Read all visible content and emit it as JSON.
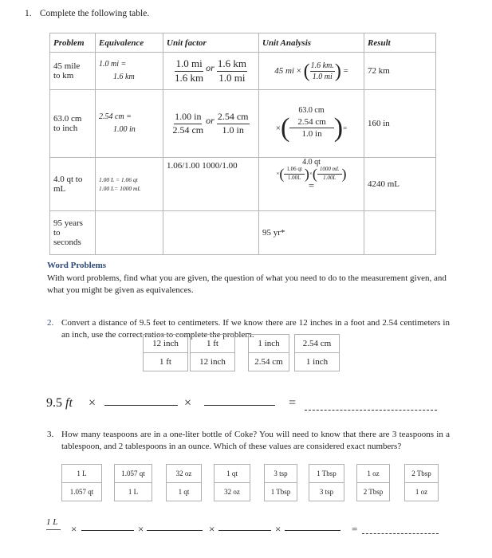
{
  "question1": {
    "number": "1.",
    "prompt": "Complete the following table.",
    "headers": [
      "Problem",
      "Equivalence",
      "Unit factor",
      "Unit Analysis",
      "Result"
    ],
    "rows": [
      {
        "problem_line1": "45 mile",
        "problem_line2": "to km",
        "equiv_line1": "1.0 mi =",
        "equiv_line2": "1.6 km",
        "factor_a_num": "1.0 mi",
        "factor_a_den": "1.6 km",
        "factor_or": "or",
        "factor_b_num": "1.6 km",
        "factor_b_den": "1.0 mi",
        "analysis_given": "45 mi",
        "analysis_times": "×",
        "analysis_num": "1.6 km.",
        "analysis_den": "1.0 mi",
        "analysis_equals": "=",
        "result": "72 km"
      },
      {
        "problem_line1": "63.0 cm",
        "problem_line2": "to inch",
        "equiv_line1": "2.54 cm =",
        "equiv_line2": "1.00 in",
        "factor_a_num": "1.00 in",
        "factor_a_den": "2.54 cm",
        "factor_or": "or",
        "factor_b_num": "2.54 cm",
        "factor_b_den": "1.0 in",
        "analysis_given": "63.0 cm",
        "analysis_times": "×",
        "analysis_num": "2.54 cm",
        "analysis_den": "1.0  in",
        "analysis_equals": "=",
        "result": "160 in"
      },
      {
        "problem_line1": "4.0 qt to",
        "problem_line2": "mL",
        "equiv_line1": "1.00 L  = 1.06 qt",
        "equiv_line2": "1.00 L= 1000 mL",
        "factor_text": "1.06/1.00    1000/1.00",
        "analysis_given": "4.0 qt",
        "analysis_times": "×",
        "analysis_num1": "1.06 qt",
        "analysis_den1": "1.00L",
        "analysis_num2": "1000 mL",
        "analysis_den2": "1.00L",
        "analysis_equals": "=",
        "result": "4240 mL"
      },
      {
        "problem_line1": "95 years",
        "problem_line2": "to",
        "problem_line3": "seconds",
        "equiv": "",
        "factor": "",
        "analysis": "95 yr*",
        "result": ""
      }
    ]
  },
  "word_problems": {
    "title": "Word Problems",
    "intro": "With word problems, find what you are given, the question of what you need to do to the measurement given, and what you might be given as equivalences."
  },
  "question2": {
    "number": "2.",
    "prompt": "Convert a distance of 9.5 feet to centimeters. If we know there are 12 inches in a foot and 2.54 centimeters in an inch, use the correct ratios to complete the problem.",
    "ratios": [
      {
        "top": "12 inch",
        "bottom": "1 ft"
      },
      {
        "top": "1 ft",
        "bottom": "12 inch"
      },
      {
        "top": "1 inch",
        "bottom": "2.54 cm"
      },
      {
        "top": "2.54 cm",
        "bottom": "1 inch"
      }
    ],
    "equation_start": "9.5 ft",
    "times": "×",
    "equals": "="
  },
  "question3": {
    "number": "3.",
    "prompt": "How many teaspoons are in a one-liter bottle of Coke?  You will need to know that there are 3 teaspoons in a tablespoon, and 2 tablespoons in an ounce.   Which of these values are considered exact numbers?",
    "ratios": [
      {
        "top": "1 L",
        "bottom": "1.057 qt"
      },
      {
        "top": "1.057 qt",
        "bottom": "1 L"
      },
      {
        "top": "32 oz",
        "bottom": "1 qt"
      },
      {
        "top": "1 qt",
        "bottom": "32 oz"
      },
      {
        "top": "3 tsp",
        "bottom": "1 Tbsp"
      },
      {
        "top": "1 Tbsp",
        "bottom": "3 tsp"
      },
      {
        "top": "1 oz",
        "bottom": "2 Tbsp"
      },
      {
        "top": "2 Tbsp",
        "bottom": "1 oz"
      }
    ],
    "equation_start": "1 L",
    "times": "×",
    "equals": "="
  }
}
